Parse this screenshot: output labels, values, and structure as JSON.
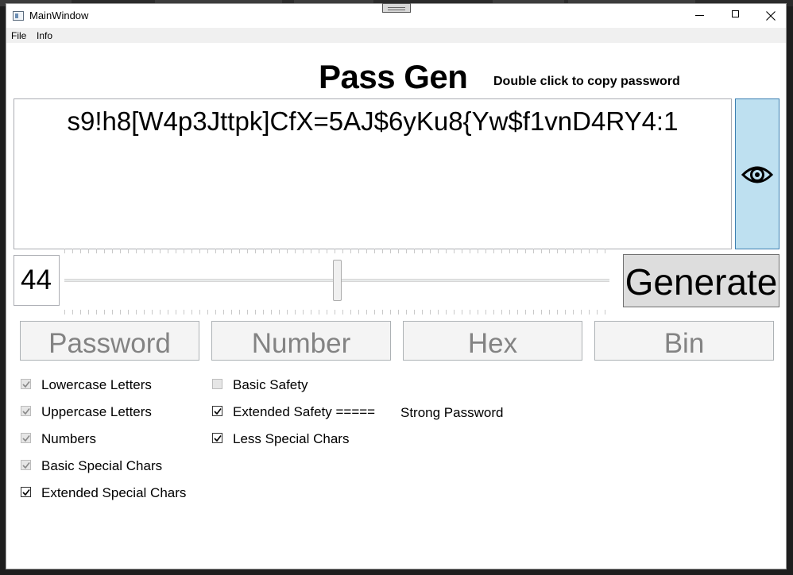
{
  "window": {
    "title": "MainWindow",
    "controls": {
      "minimize": "minimize",
      "maximize": "maximize",
      "close": "close"
    }
  },
  "menu": {
    "items": [
      "File",
      "Info"
    ]
  },
  "header": {
    "title": "Pass Gen",
    "hint": "Double click to copy password"
  },
  "password": {
    "value": "s9!h8[W4p3Jttpk]CfX=5AJ$6yKu8{Yw$f1vnD4RY4:1",
    "toggle_icon": "eye-icon"
  },
  "length": {
    "value": "44",
    "slider_level": 0.5
  },
  "generate": {
    "label": "Generate"
  },
  "modes": [
    "Password",
    "Number",
    "Hex",
    "Bin"
  ],
  "options_left": [
    {
      "label": "Lowercase Letters",
      "checked": true,
      "enabled": false
    },
    {
      "label": "Uppercase Letters",
      "checked": true,
      "enabled": false
    },
    {
      "label": "Numbers",
      "checked": true,
      "enabled": false
    },
    {
      "label": "Basic Special Chars",
      "checked": true,
      "enabled": false
    },
    {
      "label": "Extended Special Chars",
      "checked": true,
      "enabled": true
    }
  ],
  "options_right": [
    {
      "label": "Basic Safety",
      "checked": false,
      "enabled": false
    },
    {
      "label": "Extended Safety =====",
      "checked": true,
      "enabled": true
    },
    {
      "label": "Less Special Chars",
      "checked": true,
      "enabled": true
    }
  ],
  "strength": {
    "label": "Strong Password"
  }
}
